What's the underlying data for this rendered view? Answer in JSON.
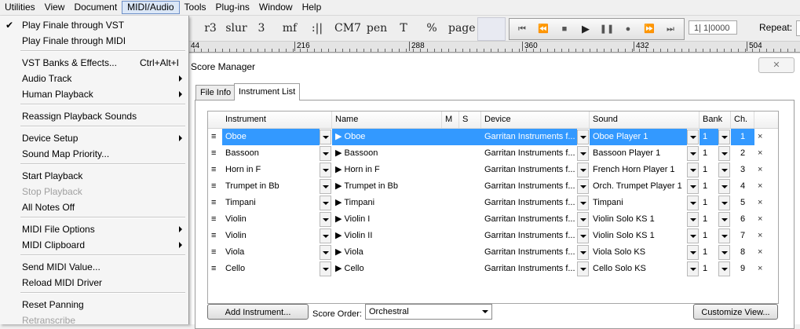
{
  "menubar": {
    "items": [
      "Utilities",
      "View",
      "Document",
      "MIDI/Audio",
      "Tools",
      "Plug-ins",
      "Window",
      "Help"
    ],
    "active_index": 3
  },
  "midi_menu": {
    "items": [
      {
        "label": "Play Finale through VST",
        "checked": true
      },
      {
        "label": "Play Finale through MIDI"
      },
      {
        "label": "VST Banks & Effects...",
        "shortcut": "Ctrl+Alt+I"
      },
      {
        "label": "Audio Track",
        "submenu": true
      },
      {
        "label": "Human Playback",
        "submenu": true
      },
      {
        "label": "Reassign Playback Sounds"
      },
      {
        "label": "Device Setup",
        "submenu": true
      },
      {
        "label": "Sound Map Priority..."
      },
      {
        "label": "Start Playback"
      },
      {
        "label": "Stop Playback",
        "disabled": true
      },
      {
        "label": "All Notes Off"
      },
      {
        "label": "MIDI File Options",
        "submenu": true
      },
      {
        "label": "MIDI Clipboard",
        "submenu": true
      },
      {
        "label": "Send MIDI Value..."
      },
      {
        "label": "Reload MIDI Driver"
      },
      {
        "label": "Reset Panning"
      },
      {
        "label": "Retranscribe",
        "disabled": true
      }
    ]
  },
  "toolbar": {
    "tools": [
      "r3",
      "slur",
      "3",
      "mf",
      ":||",
      "CM7",
      "pen",
      "T",
      "%",
      "page"
    ],
    "transport": [
      "⏮",
      "⏪",
      "■",
      "▶",
      "❚❚",
      "●",
      "⏩",
      "⏭"
    ],
    "measure_value": "1| 1|0000",
    "repeat_label": "Repeat:"
  },
  "ruler": {
    "labels": [
      "44",
      "216",
      "288",
      "360",
      "432",
      "504"
    ]
  },
  "score_manager": {
    "title": "Score Manager",
    "close_symbol": "✕",
    "tabs": [
      "File Info",
      "Instrument List"
    ],
    "active_tab": 1,
    "columns": [
      "Instrument",
      "Name",
      "M",
      "S",
      "Device",
      "Sound",
      "Bank",
      "Ch."
    ],
    "rows": [
      {
        "instrument": "Oboe",
        "name": "▶ Oboe",
        "device": "Garritan Instruments f...",
        "sound": "Oboe Player 1",
        "bank": "1",
        "ch": "1",
        "selected": true
      },
      {
        "instrument": "Bassoon",
        "name": "▶ Bassoon",
        "device": "Garritan Instruments f...",
        "sound": "Bassoon Player 1",
        "bank": "1",
        "ch": "2"
      },
      {
        "instrument": "Horn in F",
        "name": "▶ Horn in F",
        "device": "Garritan Instruments f...",
        "sound": "French Horn Player 1",
        "bank": "1",
        "ch": "3"
      },
      {
        "instrument": "Trumpet in Bb",
        "name": "▶ Trumpet in Bb",
        "device": "Garritan Instruments f...",
        "sound": "Orch. Trumpet Player 1",
        "bank": "1",
        "ch": "4"
      },
      {
        "instrument": "Timpani",
        "name": "▶ Timpani",
        "device": "Garritan Instruments f...",
        "sound": "Timpani",
        "bank": "1",
        "ch": "5"
      },
      {
        "instrument": "Violin",
        "name": "▶ Violin I",
        "device": "Garritan Instruments f...",
        "sound": "Violin Solo KS 1",
        "bank": "1",
        "ch": "6"
      },
      {
        "instrument": "Violin",
        "name": "▶ Violin II",
        "device": "Garritan Instruments f...",
        "sound": "Violin Solo KS 1",
        "bank": "1",
        "ch": "7"
      },
      {
        "instrument": "Viola",
        "name": "▶ Viola",
        "device": "Garritan Instruments f...",
        "sound": "Viola Solo KS",
        "bank": "1",
        "ch": "8"
      },
      {
        "instrument": "Cello",
        "name": "▶ Cello",
        "device": "Garritan Instruments f...",
        "sound": "Cello Solo KS",
        "bank": "1",
        "ch": "9"
      }
    ],
    "row_handle": "≡",
    "remove_symbol": "×",
    "add_instrument_label": "Add Instrument...",
    "score_order_label": "Score Order:",
    "score_order_value": "Orchestral",
    "customize_view_label": "Customize View..."
  },
  "colors": {
    "selection": "#3399ff",
    "menu_active": "#dbe7f7"
  }
}
